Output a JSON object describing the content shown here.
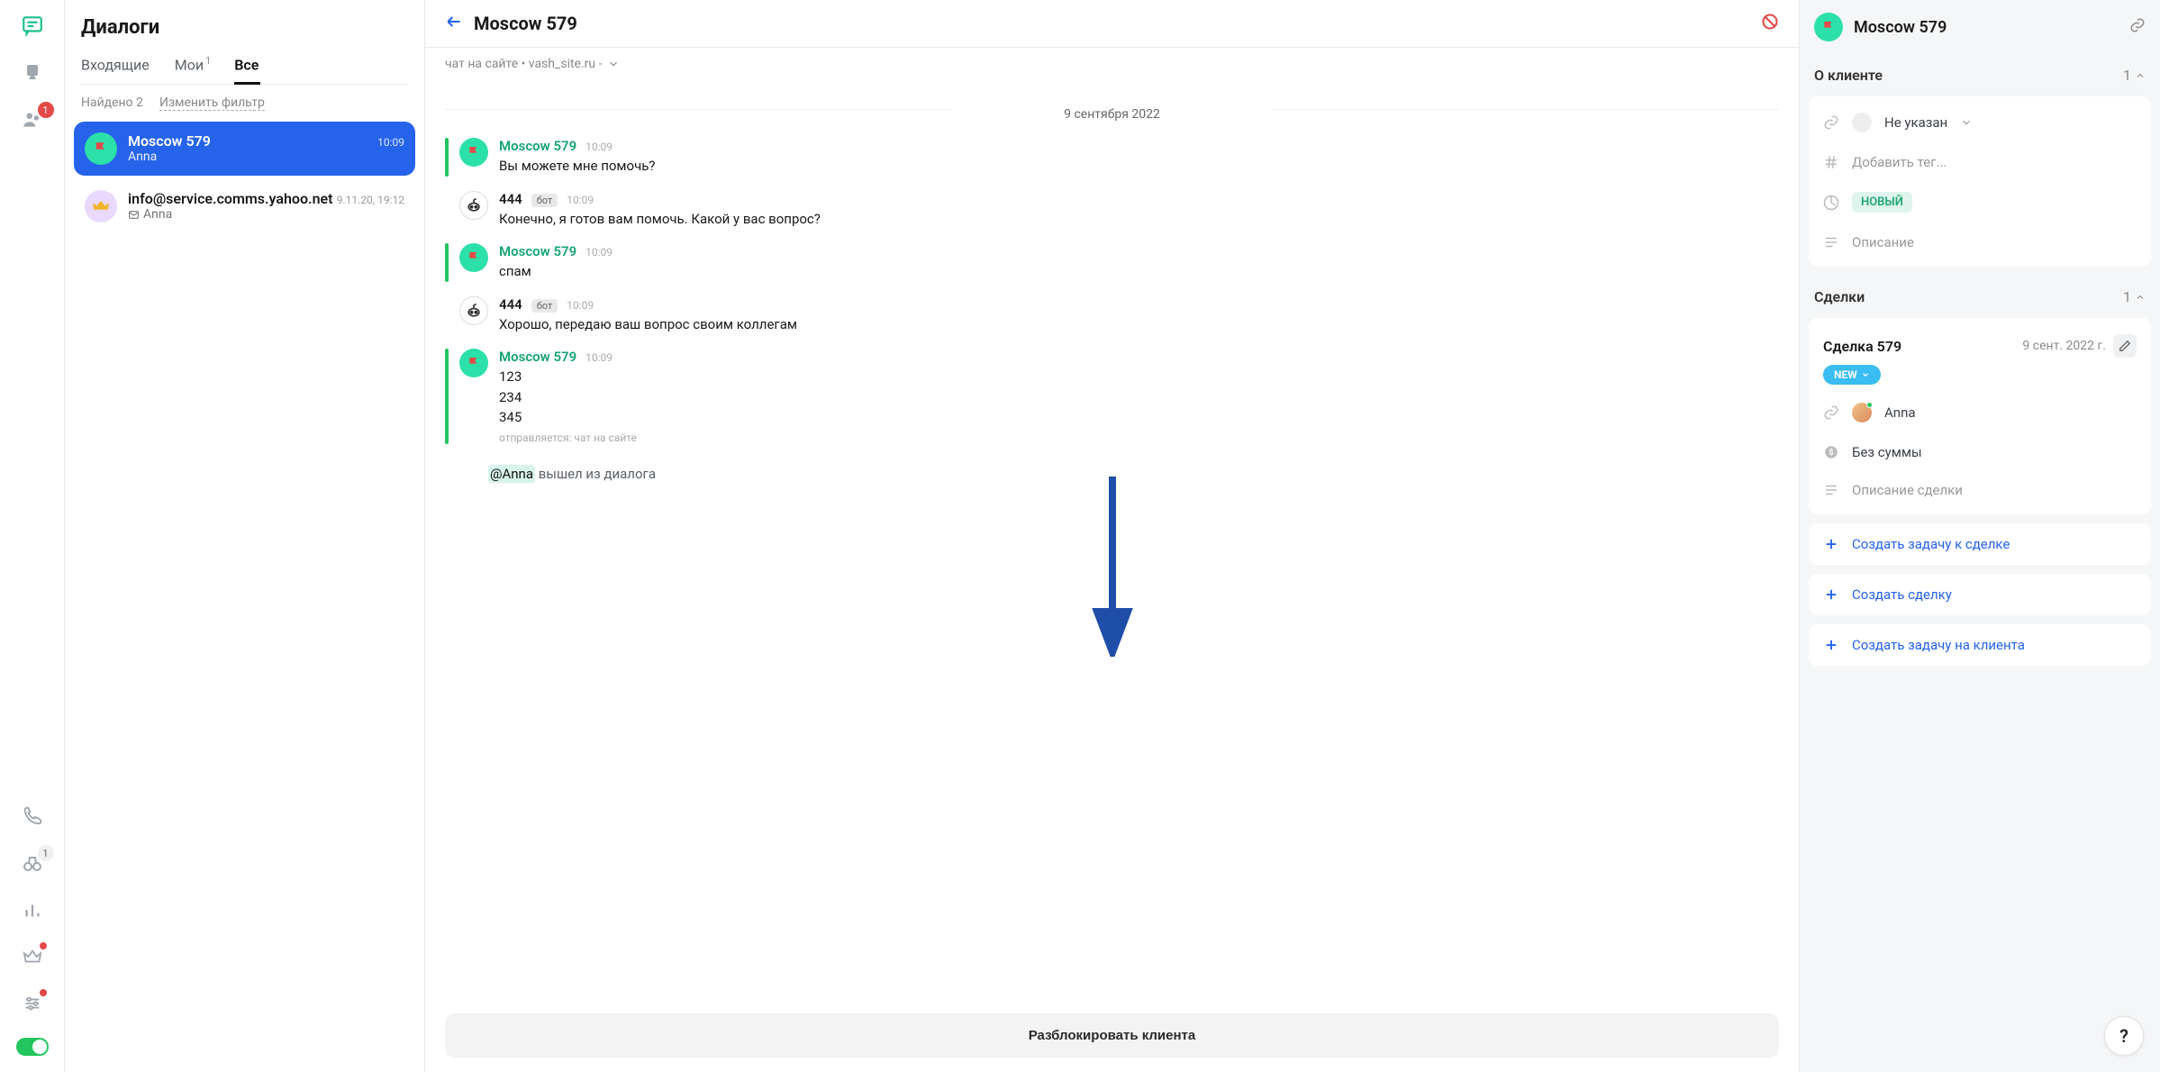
{
  "rail": {
    "team_badge": "1",
    "call_badge": "1"
  },
  "dialogs": {
    "title": "Диалоги",
    "tabs": [
      {
        "label": "Входящие",
        "badge": ""
      },
      {
        "label": "Мои",
        "badge": "1"
      },
      {
        "label": "Все",
        "badge": ""
      }
    ],
    "found": "Найдено 2",
    "change_filter": "Изменить фильтр",
    "items": [
      {
        "name": "Moscow 579",
        "time": "10:09",
        "sub": "Anna"
      },
      {
        "name": "info@service.comms.yahoo.net",
        "time": "9.11.20, 19:12",
        "sub": "Anna"
      }
    ]
  },
  "chat": {
    "title": "Moscow 579",
    "source": "чат на сайте • vash_site.ru -",
    "date": "9 сентября 2022",
    "messages": [
      {
        "name": "Moscow 579",
        "time": "10:09",
        "text": "Вы можете мне помочь?"
      },
      {
        "name": "444",
        "bot": "бот",
        "time": "10:09",
        "text": "Конечно, я готов вам помочь. Какой у вас вопрос?"
      },
      {
        "name": "Moscow 579",
        "time": "10:09",
        "text": "спам"
      },
      {
        "name": "444",
        "bot": "бот",
        "time": "10:09",
        "text": "Хорошо, передаю ваш вопрос своим коллегам"
      },
      {
        "name": "Moscow 579",
        "time": "10:09",
        "text_lines": [
          "123",
          "234",
          "345"
        ],
        "meta": "отправляется: чат на сайте"
      }
    ],
    "system_mention": "@Anna",
    "system_text": "вышел из диалога",
    "unblock": "Разблокировать клиента"
  },
  "info": {
    "title": "Moscow 579",
    "about_title": "О клиенте",
    "about_count": "1",
    "client": {
      "source": "Не указан",
      "tag_placeholder": "Добавить тег...",
      "status": "НОВЫЙ",
      "desc_placeholder": "Описание"
    },
    "deals_title": "Сделки",
    "deals_count": "1",
    "deal": {
      "name": "Сделка 579",
      "date": "9 сент. 2022 г.",
      "status": "NEW",
      "agent": "Anna",
      "amount": "Без суммы",
      "desc_placeholder": "Описание сделки"
    },
    "actions": {
      "task_to_deal": "Создать задачу к сделке",
      "create_deal": "Создать сделку",
      "task_to_client": "Создать задачу на клиента"
    }
  },
  "help": "?"
}
